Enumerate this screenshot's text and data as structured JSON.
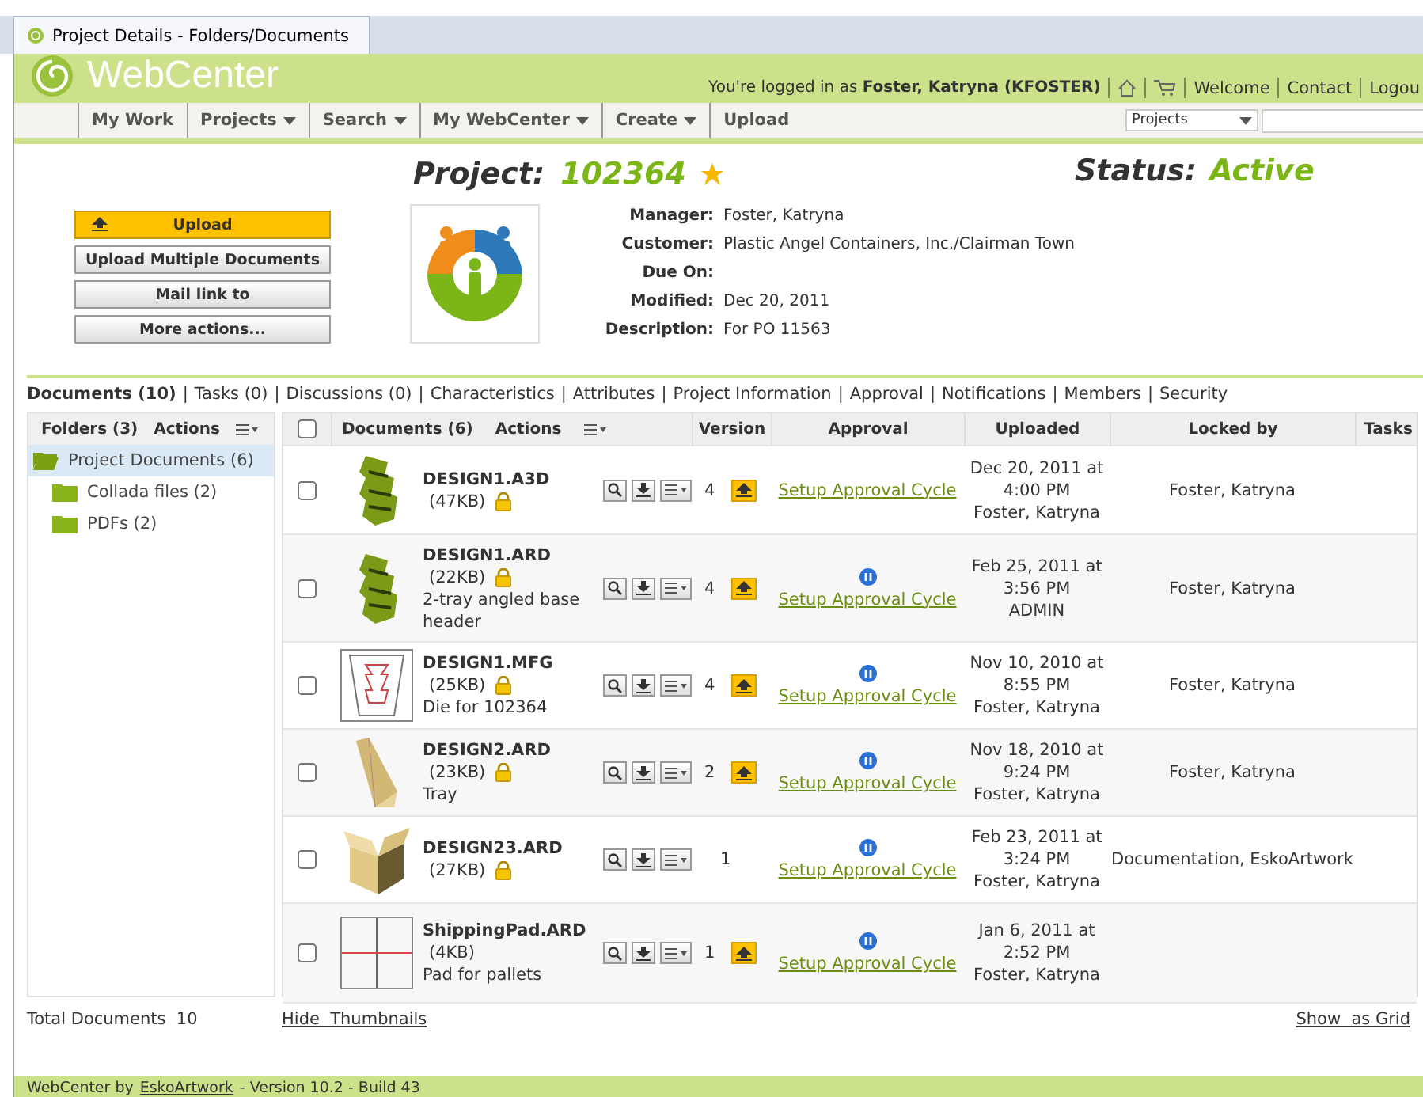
{
  "browser_tab": {
    "title": "Project Details - Folders/Documents"
  },
  "header": {
    "logo": "WebCenter",
    "login_prefix": "You're logged in as",
    "user": "Foster, Katryna (KFOSTER)",
    "links": [
      "Welcome",
      "Contact",
      "Logou"
    ]
  },
  "nav": {
    "items": [
      {
        "label": "My Work",
        "has_menu": false
      },
      {
        "label": "Projects",
        "has_menu": true
      },
      {
        "label": "Search",
        "has_menu": true
      },
      {
        "label": "My WebCenter",
        "has_menu": true
      },
      {
        "label": "Create",
        "has_menu": true
      },
      {
        "label": "Upload",
        "has_menu": false
      }
    ],
    "search_scope": "Projects"
  },
  "project": {
    "label": "Project:",
    "number": "102364",
    "favorite": true,
    "status_label": "Status:",
    "status": "Active",
    "buttons": [
      {
        "label": "Upload",
        "primary": true
      },
      {
        "label": "Upload Multiple Documents",
        "primary": false
      },
      {
        "label": "Mail link to",
        "primary": false
      },
      {
        "label": "More actions...",
        "primary": false
      }
    ],
    "fields": [
      {
        "label": "Manager:",
        "value": "Foster, Katryna"
      },
      {
        "label": "Customer:",
        "value": "Plastic Angel Containers, Inc./Clairman Town"
      },
      {
        "label": "Due On:"
      },
      {
        "label": "Modified:",
        "value": "Dec 20, 2011"
      },
      {
        "label": "Description:",
        "value": "For PO 11563"
      }
    ]
  },
  "tabs": {
    "separator": "|",
    "items": [
      {
        "label": "Documents (10)",
        "selected": true
      },
      {
        "label": "Tasks (0)",
        "selected": false
      },
      {
        "label": "Discussions (0)",
        "selected": false
      },
      {
        "label": "Characteristics",
        "selected": false
      },
      {
        "label": "Attributes",
        "selected": false
      },
      {
        "label": "Project Information",
        "selected": false
      },
      {
        "label": "Approval",
        "selected": false
      },
      {
        "label": "Notifications",
        "selected": false
      },
      {
        "label": "Members",
        "selected": false
      },
      {
        "label": "Security",
        "selected": false
      }
    ]
  },
  "folders": {
    "title": "Folders (3)",
    "actions": "Actions",
    "items": [
      {
        "label": "Project Documents (6)",
        "selected": true,
        "expanded": true,
        "children": [
          {
            "label": "Collada files (2)",
            "selected": false,
            "expanded": false
          },
          {
            "label": "PDFs (2)",
            "selected": false,
            "expanded": false
          }
        ]
      }
    ]
  },
  "table": {
    "select_all_checked": false,
    "title": "Documents (6)",
    "actions": "Actions",
    "columns": [
      "Version",
      "Approval",
      "Uploaded",
      "Locked by",
      "Tasks"
    ],
    "rows": [
      {
        "checked": false,
        "kind": "stand",
        "name": "DESIGN1.A3D",
        "size": "(47KB)",
        "locked": true,
        "version": "4",
        "new_version": true,
        "approval_pending": false,
        "approval": "Setup Approval Cycle",
        "uploaded_date": "Dec 20, 2011 at",
        "uploaded_time": "4:00 PM",
        "uploaded_by": "Foster, Katryna",
        "locked_by": "Foster, Katryna"
      },
      {
        "checked": false,
        "kind": "stand",
        "name": "DESIGN1.ARD",
        "size": "(22KB)",
        "locked": true,
        "description": "2-tray angled base header",
        "version": "4",
        "new_version": true,
        "approval_pending": true,
        "approval": "Setup Approval Cycle",
        "uploaded_date": "Feb 25, 2011 at",
        "uploaded_time": "3:56 PM",
        "uploaded_by": "ADMIN",
        "locked_by": "Foster, Katryna"
      },
      {
        "checked": false,
        "kind": "die",
        "name": "DESIGN1.MFG",
        "size": "(25KB)",
        "locked": true,
        "description": "Die for 102364",
        "version": "4",
        "new_version": true,
        "approval_pending": true,
        "approval": "Setup Approval Cycle",
        "uploaded_date": "Nov 10, 2010 at",
        "uploaded_time": "8:55 PM",
        "uploaded_by": "Foster, Katryna",
        "locked_by": "Foster, Katryna"
      },
      {
        "checked": false,
        "kind": "tray",
        "name": "DESIGN2.ARD",
        "size": "(23KB)",
        "locked": true,
        "description": "Tray",
        "version": "2",
        "new_version": true,
        "approval_pending": true,
        "approval": "Setup Approval Cycle",
        "uploaded_date": "Nov 18, 2010 at",
        "uploaded_time": "9:24 PM",
        "uploaded_by": "Foster, Katryna",
        "locked_by": "Foster, Katryna"
      },
      {
        "checked": false,
        "kind": "box",
        "name": "DESIGN23.ARD",
        "size": "(27KB)",
        "locked": true,
        "version": "1",
        "new_version": false,
        "approval_pending": true,
        "approval": "Setup Approval Cycle",
        "uploaded_date": "Feb 23, 2011 at",
        "uploaded_time": "3:24 PM",
        "uploaded_by": "Foster, Katryna",
        "locked_by": "Documentation, EskoArtwork"
      },
      {
        "checked": false,
        "kind": "pad",
        "name": "ShippingPad.ARD",
        "size": "(4KB)",
        "locked": false,
        "description": "Pad for pallets",
        "version": "1",
        "new_version": true,
        "approval_pending": true,
        "approval": "Setup Approval Cycle",
        "uploaded_date": "Jan 6, 2011 at",
        "uploaded_time": "2:52 PM",
        "uploaded_by": "Foster, Katryna"
      }
    ]
  },
  "summary": {
    "label": "Total Documents",
    "count": "10",
    "hide_thumbnails": "Hide  Thumbnails",
    "show_grid": "Show  as Grid"
  },
  "footer": {
    "prefix": "WebCenter by",
    "company": "EskoArtwork",
    "suffix": "- Version 10.2 - Build 43"
  }
}
